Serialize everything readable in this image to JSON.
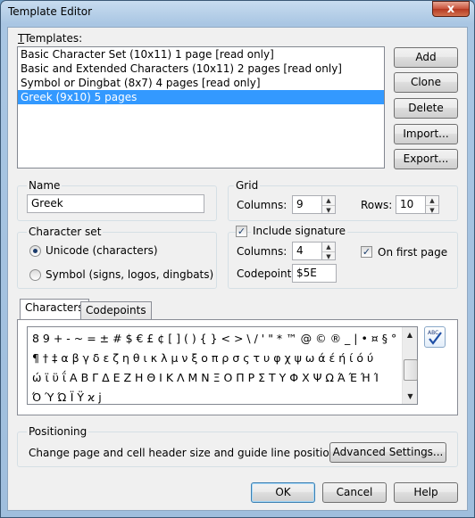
{
  "window": {
    "title": "Template Editor",
    "close_glyph": "x"
  },
  "templates": {
    "label": "Templates:",
    "items": [
      "Basic Character Set (10x11) 1 page [read only]",
      "Basic and Extended Characters (10x11) 2 pages [read only]",
      "Symbol or Dingbat (8x7) 4 pages [read only]",
      "Greek (9x10) 5 pages"
    ],
    "selected_index": 3
  },
  "side_buttons": [
    "Add",
    "Clone",
    "Delete",
    "Import...",
    "Export..."
  ],
  "name": {
    "label": "Name",
    "value": "Greek"
  },
  "grid": {
    "label": "Grid",
    "columns_label": "Columns:",
    "columns": "9",
    "rows_label": "Rows:",
    "rows": "10"
  },
  "charset": {
    "label": "Character set",
    "unicode": "Unicode (characters)",
    "symbol": "Symbol (signs, logos, dingbats)",
    "selected": "unicode"
  },
  "signature": {
    "include_label": "Include signature",
    "include_checked": true,
    "columns_label": "Columns:",
    "columns": "4",
    "codepoint_label": "Codepoint:",
    "codepoint": "$5E",
    "first_page_label": "On first page",
    "first_page_checked": true
  },
  "tabs": [
    "Characters",
    "Codepoints"
  ],
  "characters": {
    "lines": [
      "8 9 + - ~ = ± # $ € £ ¢ [ ] ( ) { } < > \\ / ' \" * ™ @ © ® _ | • ¤ § °",
      "¶ † ‡ α β γ δ ε ζ η θ ι κ λ μ ν ξ ο π ρ σ ς τ υ φ χ ψ ω ά έ ή ί ό ύ",
      "ώ ϊ ϋ ΐ Α Β Γ Δ Ε Ζ Η Θ Ι Κ Λ Μ Ν Ξ Ο Π Ρ Σ Τ Υ Φ Χ Ψ Ω Ά Έ Ή Ί",
      "Ό Ύ Ώ Ϊ Ϋ ϰ ϳ"
    ]
  },
  "positioning": {
    "label": "Positioning",
    "text": "Change page and cell header size and guide line positions",
    "button": "Advanced Settings..."
  },
  "footer": {
    "ok": "OK",
    "cancel": "Cancel",
    "help": "Help"
  }
}
